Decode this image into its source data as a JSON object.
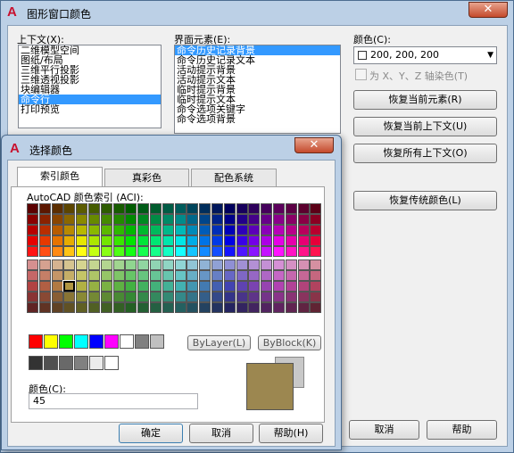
{
  "window": {
    "title": "图形窗口颜色",
    "close": "✕"
  },
  "context": {
    "label": "上下文(X):",
    "items": [
      "二维模型空间",
      "图纸/布局",
      "三维平行投影",
      "三维透视投影",
      "块编辑器",
      "命令行",
      "打印预览"
    ],
    "selected_index": 5
  },
  "elements": {
    "label": "界面元素(E):",
    "items": [
      "命令历史记录背景",
      "命令历史记录文本",
      "活动提示背景",
      "活动提示文本",
      "临时提示背景",
      "临时提示文本",
      "命令选项关键字",
      "命令选项背景"
    ],
    "selected_index": 0
  },
  "color": {
    "label": "颜色(C):",
    "value": "200, 200, 200"
  },
  "tint": {
    "label": "为 X、Y、Z 轴染色(T)"
  },
  "buttons": {
    "restore_element": "恢复当前元素(R)",
    "restore_context": "恢复当前上下文(U)",
    "restore_all": "恢复所有上下文(O)",
    "restore_classic": "恢复传统颜色(L)",
    "cancel": "取消",
    "help": "帮助"
  },
  "dialog": {
    "title": "选择颜色",
    "close": "✕",
    "tabs": [
      "索引颜色",
      "真彩色",
      "配色系统"
    ],
    "aci_label": "AutoCAD 颜色索引 (ACI):",
    "bylayer": "ByLayer(L)",
    "byblock": "ByBlock(K)",
    "color_label": "颜色(C):",
    "color_value": "45",
    "ok": "确定",
    "cancel": "取消",
    "help": "帮助(H)",
    "selected_color": "#9c8750",
    "previous_color": "#c8c8c8"
  }
}
